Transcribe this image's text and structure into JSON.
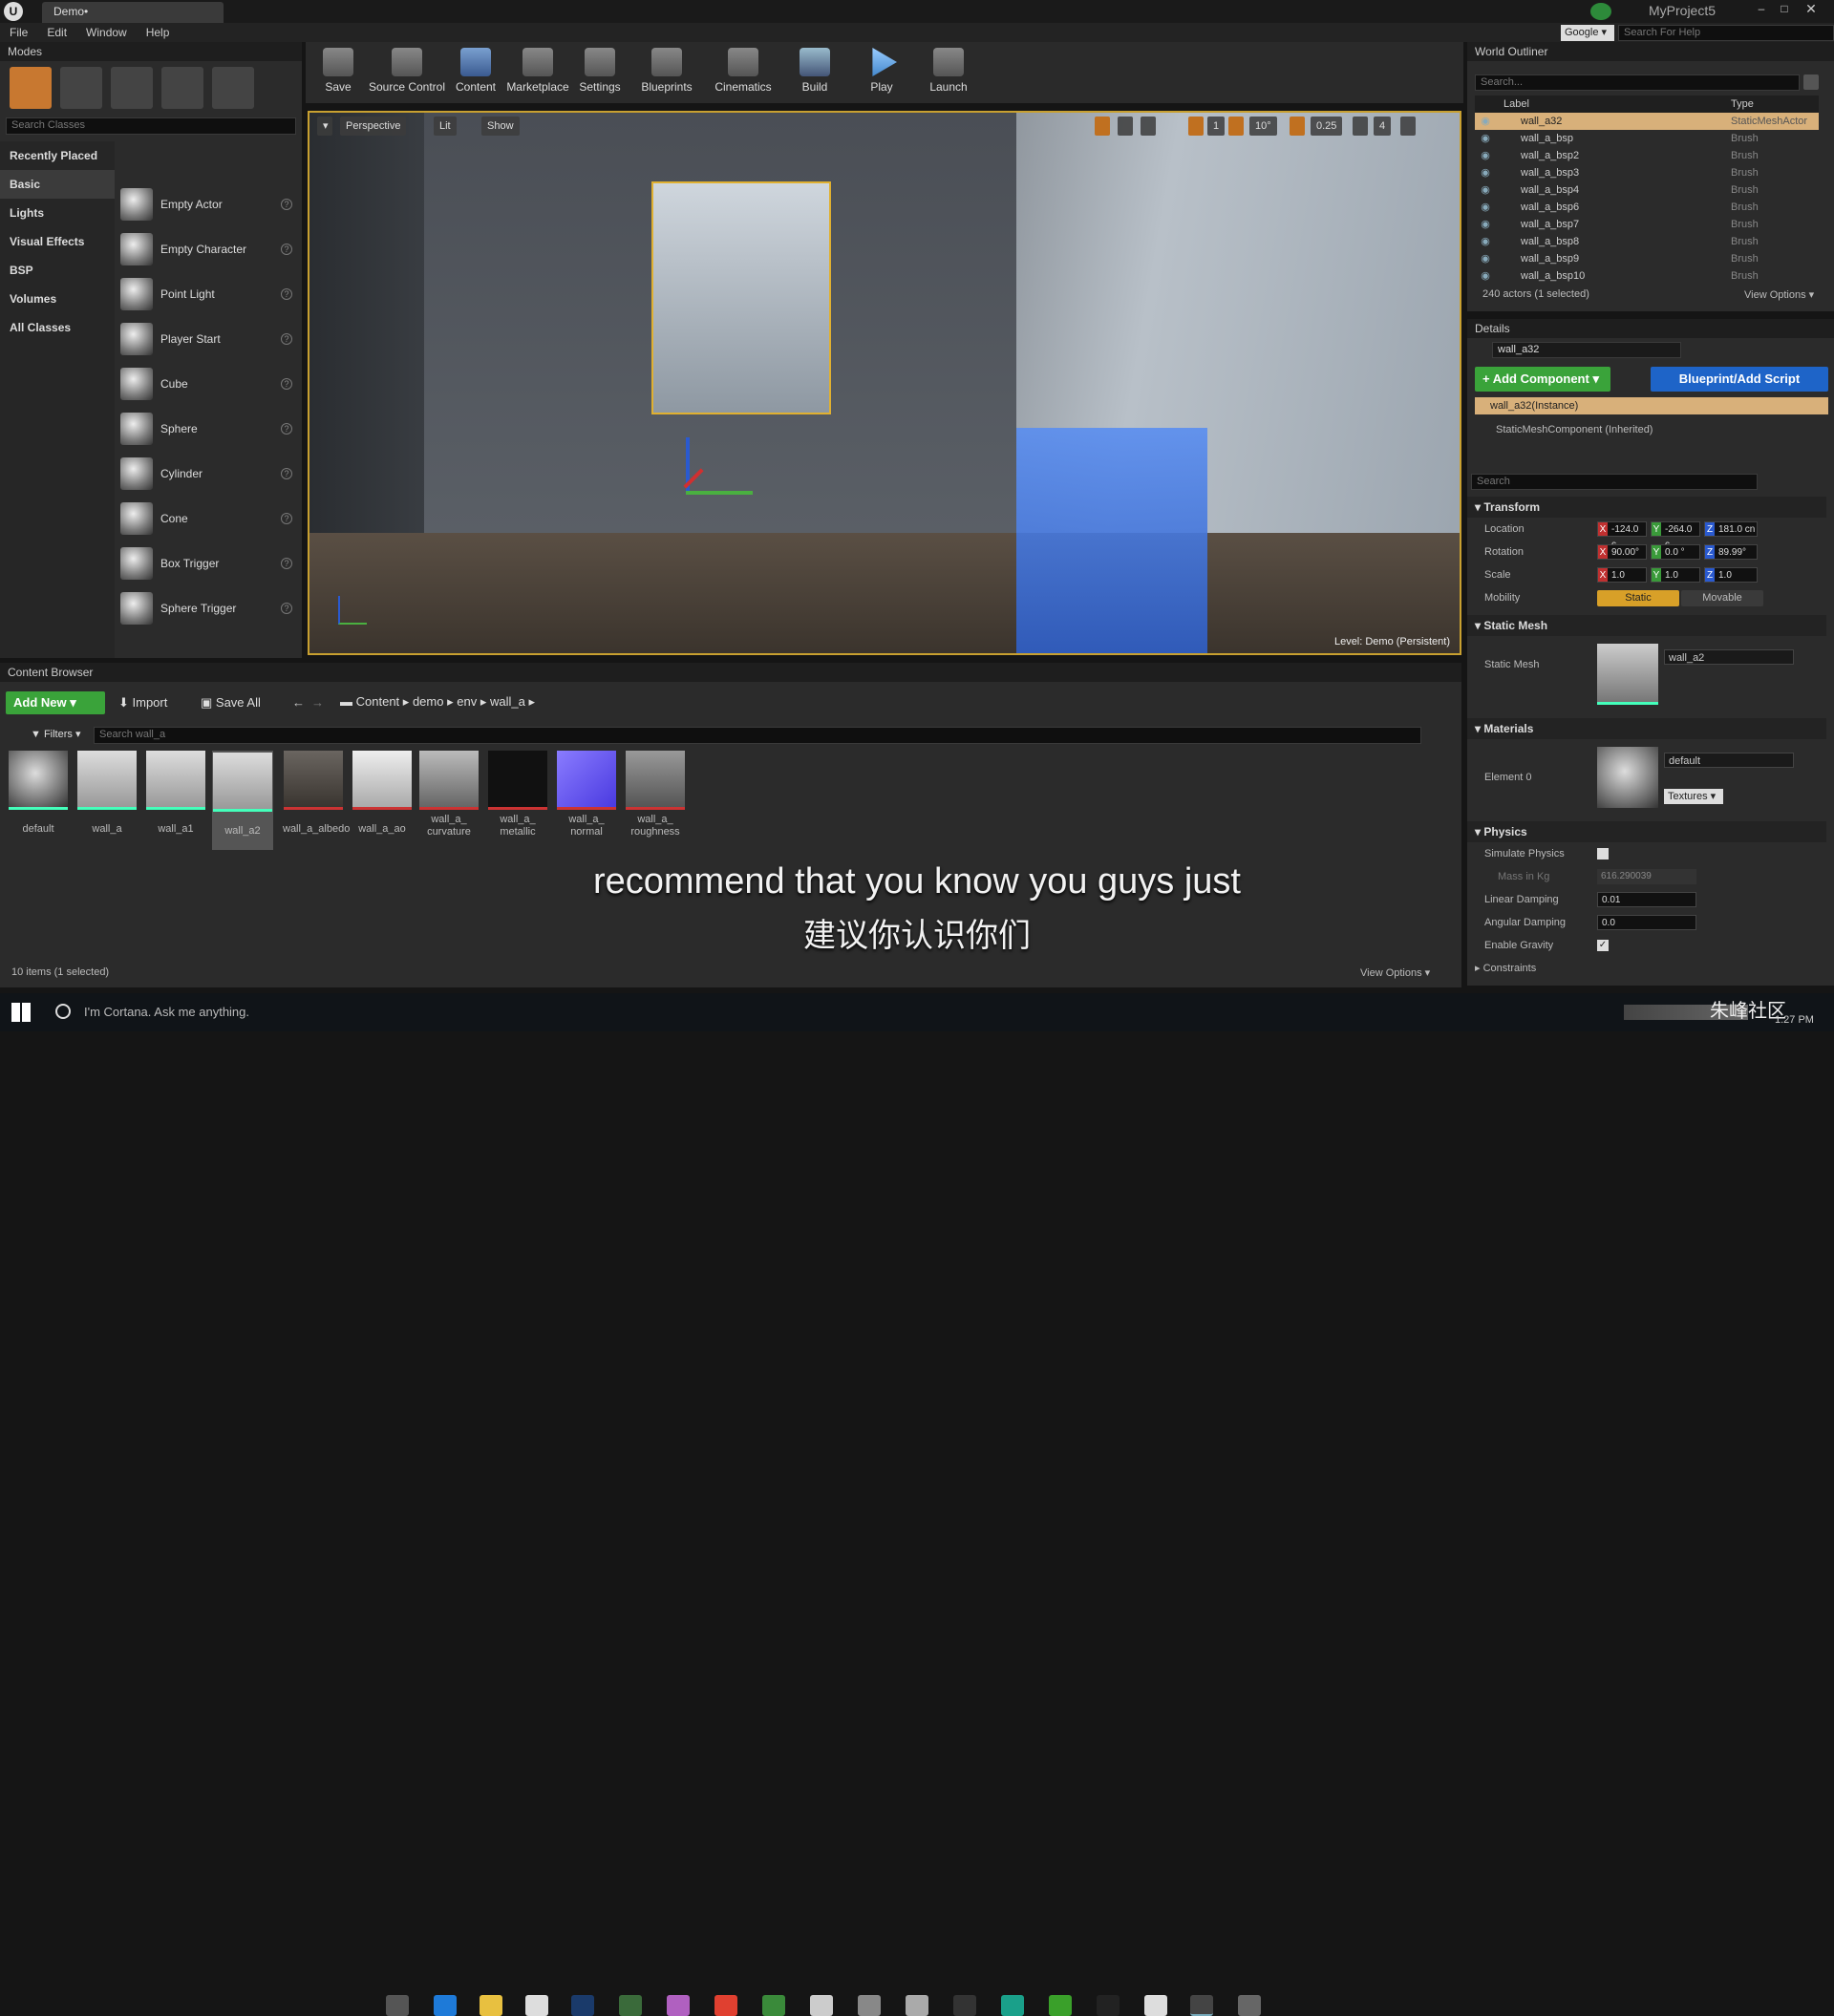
{
  "app": {
    "tab_title": "Demo•",
    "project": "MyProject5",
    "help_search_placeholder": "Search For Help",
    "google_label": "Google"
  },
  "menu": [
    "File",
    "Edit",
    "Window",
    "Help"
  ],
  "modes": {
    "title": "Modes",
    "search_placeholder": "Search Classes",
    "categories": [
      "Recently Placed",
      "Basic",
      "Lights",
      "Visual Effects",
      "BSP",
      "Volumes",
      "All Classes"
    ],
    "items": [
      "Empty Actor",
      "Empty Character",
      "Point Light",
      "Player Start",
      "Cube",
      "Sphere",
      "Cylinder",
      "Cone",
      "Box Trigger",
      "Sphere Trigger"
    ]
  },
  "toolbar": [
    "Save",
    "Source Control",
    "Content",
    "Marketplace",
    "Settings",
    "Blueprints",
    "Cinematics",
    "Build",
    "Play",
    "Launch"
  ],
  "viewport": {
    "perspective": "Perspective",
    "lit": "Lit",
    "show": "Show",
    "grid": "1",
    "angle": "10°",
    "scale": "0.25",
    "cam": "4",
    "level": "Level:  Demo (Persistent)"
  },
  "outliner": {
    "title": "World Outliner",
    "search_placeholder": "Search...",
    "col_label": "Label",
    "col_type": "Type",
    "rows": [
      [
        "wall_a32",
        "StaticMeshActor"
      ],
      [
        "wall_a_bsp",
        "Brush"
      ],
      [
        "wall_a_bsp2",
        "Brush"
      ],
      [
        "wall_a_bsp3",
        "Brush"
      ],
      [
        "wall_a_bsp4",
        "Brush"
      ],
      [
        "wall_a_bsp6",
        "Brush"
      ],
      [
        "wall_a_bsp7",
        "Brush"
      ],
      [
        "wall_a_bsp8",
        "Brush"
      ],
      [
        "wall_a_bsp9",
        "Brush"
      ],
      [
        "wall_a_bsp10",
        "Brush"
      ]
    ],
    "status": "240 actors (1 selected)",
    "view_options": "View Options"
  },
  "details": {
    "title": "Details",
    "name": "wall_a32",
    "add_component": "+ Add Component",
    "blueprint": "Blueprint/Add Script",
    "instance": "wall_a32(Instance)",
    "component": "StaticMeshComponent (Inherited)",
    "search_placeholder": "Search",
    "transform": "Transform",
    "location_label": "Location",
    "rotation_label": "Rotation",
    "scale_label": "Scale",
    "mobility_label": "Mobility",
    "location": [
      "-124.0 c",
      "-264.0 c",
      "181.0 cn"
    ],
    "rotation": [
      "90.00°",
      "0.0 °",
      "89.99°"
    ],
    "scale": [
      "1.0",
      "1.0",
      "1.0"
    ],
    "static": "Static",
    "movable": "Movable",
    "static_mesh_section": "Static Mesh",
    "static_mesh_label": "Static Mesh",
    "static_mesh_value": "wall_a2",
    "materials_section": "Materials",
    "element0": "Element 0",
    "material_value": "default",
    "textures": "Textures",
    "physics_section": "Physics",
    "simulate": "Simulate Physics",
    "mass": "Mass in Kg",
    "mass_value": "616.290039",
    "linear": "Linear Damping",
    "linear_value": "0.01",
    "angular": "Angular Damping",
    "angular_value": "0.0",
    "gravity": "Enable Gravity",
    "constraints": "Constraints"
  },
  "content": {
    "title": "Content Browser",
    "add_new": "Add New",
    "import": "Import",
    "save_all": "Save All",
    "path": [
      "Content",
      "demo",
      "env",
      "wall_a"
    ],
    "filters": "Filters",
    "search_placeholder": "Search wall_a",
    "assets": [
      "default",
      "wall_a",
      "wall_a1",
      "wall_a2",
      "wall_a_albedo",
      "wall_a_ao",
      "wall_a_\ncurvature",
      "wall_a_\nmetallic",
      "wall_a_\nnormal",
      "wall_a_\nroughness"
    ],
    "status": "10 items (1 selected)",
    "view_options": "View Options"
  },
  "subtitle": {
    "en": "recommend that you know you guys just",
    "zh": "建议你认识你们"
  },
  "taskbar": {
    "cortana": "I'm Cortana. Ask me anything.",
    "clock": "1:27 PM",
    "watermark": "朱峰社区"
  },
  "colors": {
    "accent_orange": "#f0a020",
    "green": "#3aa33a",
    "blue": "#1e64c8"
  }
}
